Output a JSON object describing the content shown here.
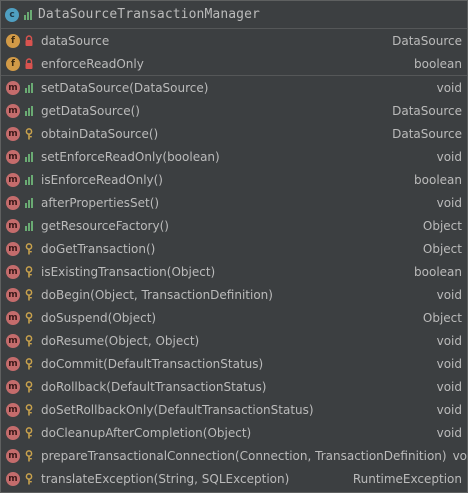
{
  "header": {
    "title": "DataSourceTransactionManager",
    "badge": "c"
  },
  "fields": [
    {
      "name": "dataSource",
      "type": "DataSource"
    },
    {
      "name": "enforceReadOnly",
      "type": "boolean"
    }
  ],
  "methods": [
    {
      "name": "setDataSource(DataSource)",
      "type": "void",
      "visibility": "public"
    },
    {
      "name": "getDataSource()",
      "type": "DataSource",
      "visibility": "public"
    },
    {
      "name": "obtainDataSource()",
      "type": "DataSource",
      "visibility": "protected"
    },
    {
      "name": "setEnforceReadOnly(boolean)",
      "type": "void",
      "visibility": "public"
    },
    {
      "name": "isEnforceReadOnly()",
      "type": "boolean",
      "visibility": "public"
    },
    {
      "name": "afterPropertiesSet()",
      "type": "void",
      "visibility": "public"
    },
    {
      "name": "getResourceFactory()",
      "type": "Object",
      "visibility": "public"
    },
    {
      "name": "doGetTransaction()",
      "type": "Object",
      "visibility": "protected"
    },
    {
      "name": "isExistingTransaction(Object)",
      "type": "boolean",
      "visibility": "protected"
    },
    {
      "name": "doBegin(Object, TransactionDefinition)",
      "type": "void",
      "visibility": "protected"
    },
    {
      "name": "doSuspend(Object)",
      "type": "Object",
      "visibility": "protected"
    },
    {
      "name": "doResume(Object, Object)",
      "type": "void",
      "visibility": "protected"
    },
    {
      "name": "doCommit(DefaultTransactionStatus)",
      "type": "void",
      "visibility": "protected"
    },
    {
      "name": "doRollback(DefaultTransactionStatus)",
      "type": "void",
      "visibility": "protected"
    },
    {
      "name": "doSetRollbackOnly(DefaultTransactionStatus)",
      "type": "void",
      "visibility": "protected"
    },
    {
      "name": "doCleanupAfterCompletion(Object)",
      "type": "void",
      "visibility": "protected"
    },
    {
      "name": "prepareTransactionalConnection(Connection, TransactionDefinition)",
      "type": "void",
      "visibility": "protected"
    },
    {
      "name": "translateException(String, SQLException)",
      "type": "RuntimeException",
      "visibility": "protected"
    }
  ],
  "colors": {
    "background": "#3c3f41",
    "text": "#bbbbbb",
    "class_badge": "#4f9fc1",
    "field_badge": "#d19a47",
    "method_badge": "#c46c6c",
    "public_icon": "#6aab73",
    "private_icon": "#d9534f",
    "protected_icon": "#c9a24d"
  },
  "icons": {
    "class": "class-icon",
    "field": "field-icon",
    "method": "method-icon",
    "public": "public-visibility-icon",
    "private": "private-lock-icon",
    "protected": "protected-key-icon"
  }
}
